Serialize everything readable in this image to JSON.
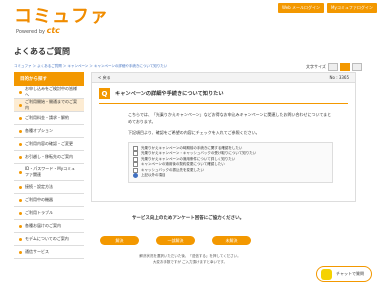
{
  "header": {
    "logo_text": "コミュファ",
    "logo_sub": "Powered by",
    "logo_brand": "ctc",
    "links": [
      "Web メールログイン",
      "Myコミュファログイン"
    ]
  },
  "page_title": "よくあるご質問",
  "breadcrumb": "コミュファ ＞ よくあるご質問 ＞ キャンペーン ＞ キャンペーンの詳細や手続きについて知りたい",
  "font_size": {
    "label": "文字サイズ",
    "options": [
      "小",
      "中",
      "大"
    ]
  },
  "sidebar": {
    "head": "目的から探す",
    "items": [
      "お申し込みをご検討中の皆様へ",
      "ご利用開始・開通までのご案内",
      "ご利用料金・請求・解約",
      "各種オプション",
      "ご利用内容の確認・ご変更",
      "お引越し・移転先のご案内",
      "ID・パスワード・Myコミュファ関連",
      "接続・設定方法",
      "ご利用中の機器",
      "ご利用トラブル",
      "各種お届けのご案内",
      "モデムについてのご案内",
      "通信サービス"
    ],
    "selected_index": 1
  },
  "main": {
    "back_label": "< 戻る",
    "number": "No : 3365",
    "q_icon": "Q",
    "question": "キャンペーンの詳細や手続きについて知りたい",
    "answer_p1": "こちらでは、「光乗りかえキャンペーン」などお得なお申込みキャンペーンに関連したお問い合わせについてまとめております。",
    "answer_p2": "下記項目より、確認をご希望の内容にチェックを入れてご参照ください。",
    "checklist": [
      "光乗りかえキャンペーンの時期前の手続きに関する確認をしたい",
      "光乗りかえキャンペーン・キャッシュバックの受け取りについて知りたい",
      "光乗りかえキャンペーンの適用条件について詳しく知りたい",
      "キャンペーンの適用後の契約変更について確認したい",
      "キャッシュバックの振込先を変更したい",
      "上記以外の項目"
    ],
    "checked_index": 5
  },
  "survey": {
    "title": "サービス向上のためアンケート回答にご協力ください。",
    "buttons": [
      "解決",
      "一部解決",
      "未解決"
    ],
    "text": "解決状況を選択いただいた後、「送信する」を押してください。\n大変お手数ですが ご入力頂けますと幸いです。"
  },
  "chat": {
    "label": "チャットで質問"
  }
}
